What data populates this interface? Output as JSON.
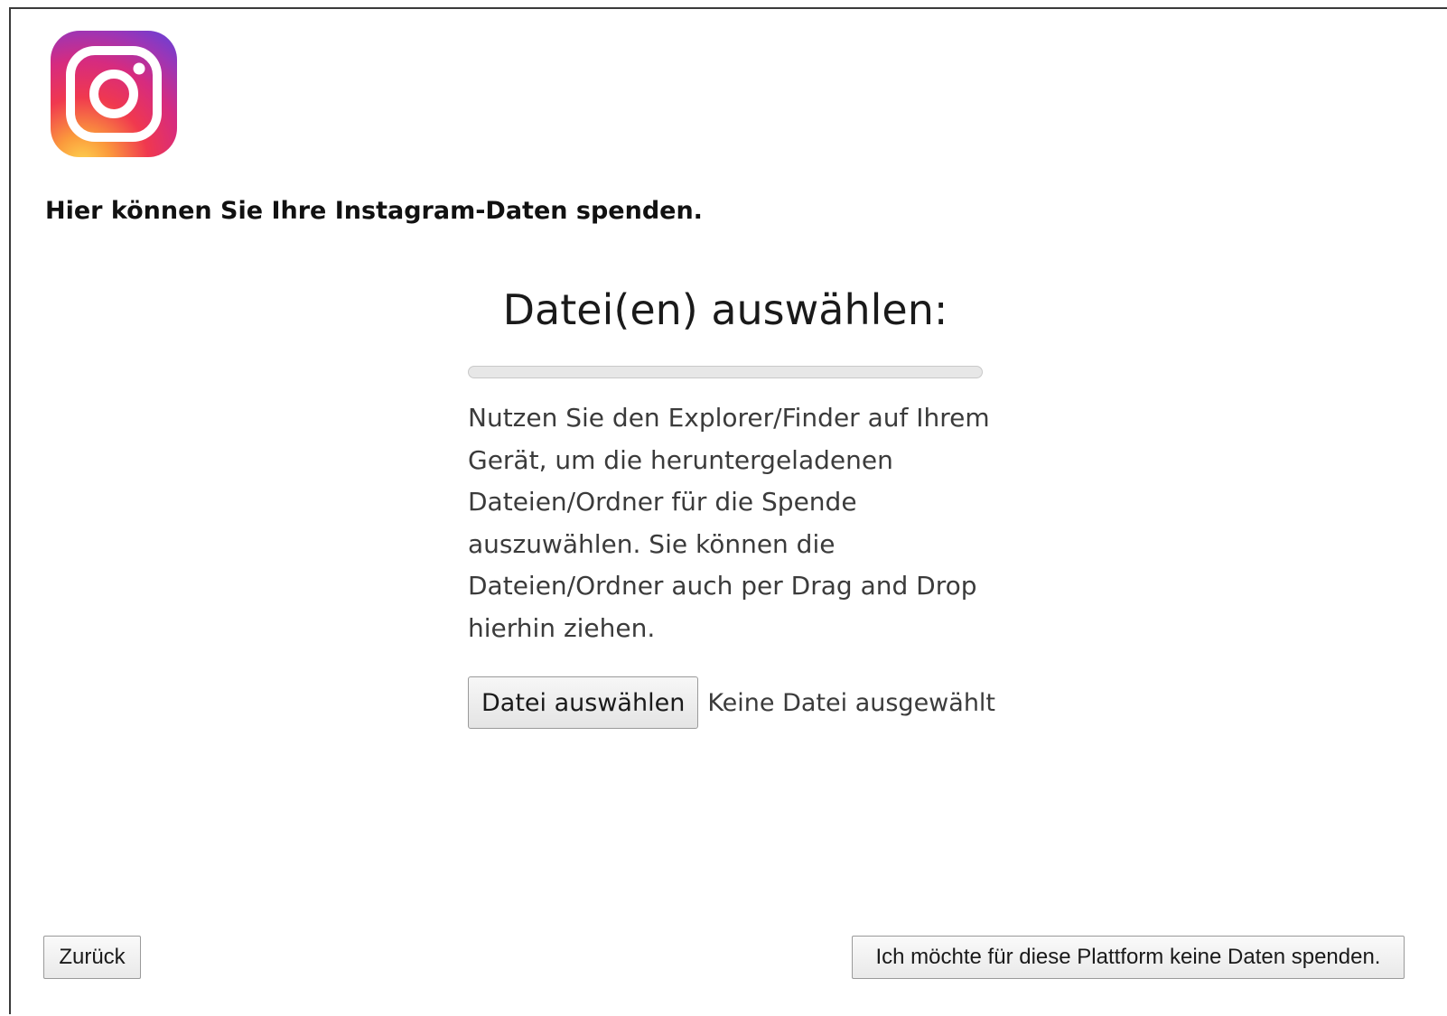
{
  "logo": {
    "name": "instagram-logo"
  },
  "intro_text": "Hier können Sie Ihre Instagram-Daten spenden.",
  "upload": {
    "heading": "Datei(en) auswählen:",
    "progress_percent": 0,
    "description": "Nutzen Sie den Explorer/Finder auf Ihrem Gerät, um die heruntergeladenen Dateien/Ordner für die Spende auszuwählen. Sie können die Dateien/Ordner auch per Drag and Drop hierhin ziehen.",
    "choose_button_label": "Datei auswählen",
    "no_file_text": "Keine Datei ausgewählt"
  },
  "footer": {
    "back_label": "Zurück",
    "skip_label": "Ich möchte für diese Plattform keine Daten spenden."
  },
  "colors": {
    "logo_gradient": [
      "#fdc830",
      "#f37335",
      "#e1306c",
      "#c13584",
      "#833ab4",
      "#5851db"
    ]
  }
}
